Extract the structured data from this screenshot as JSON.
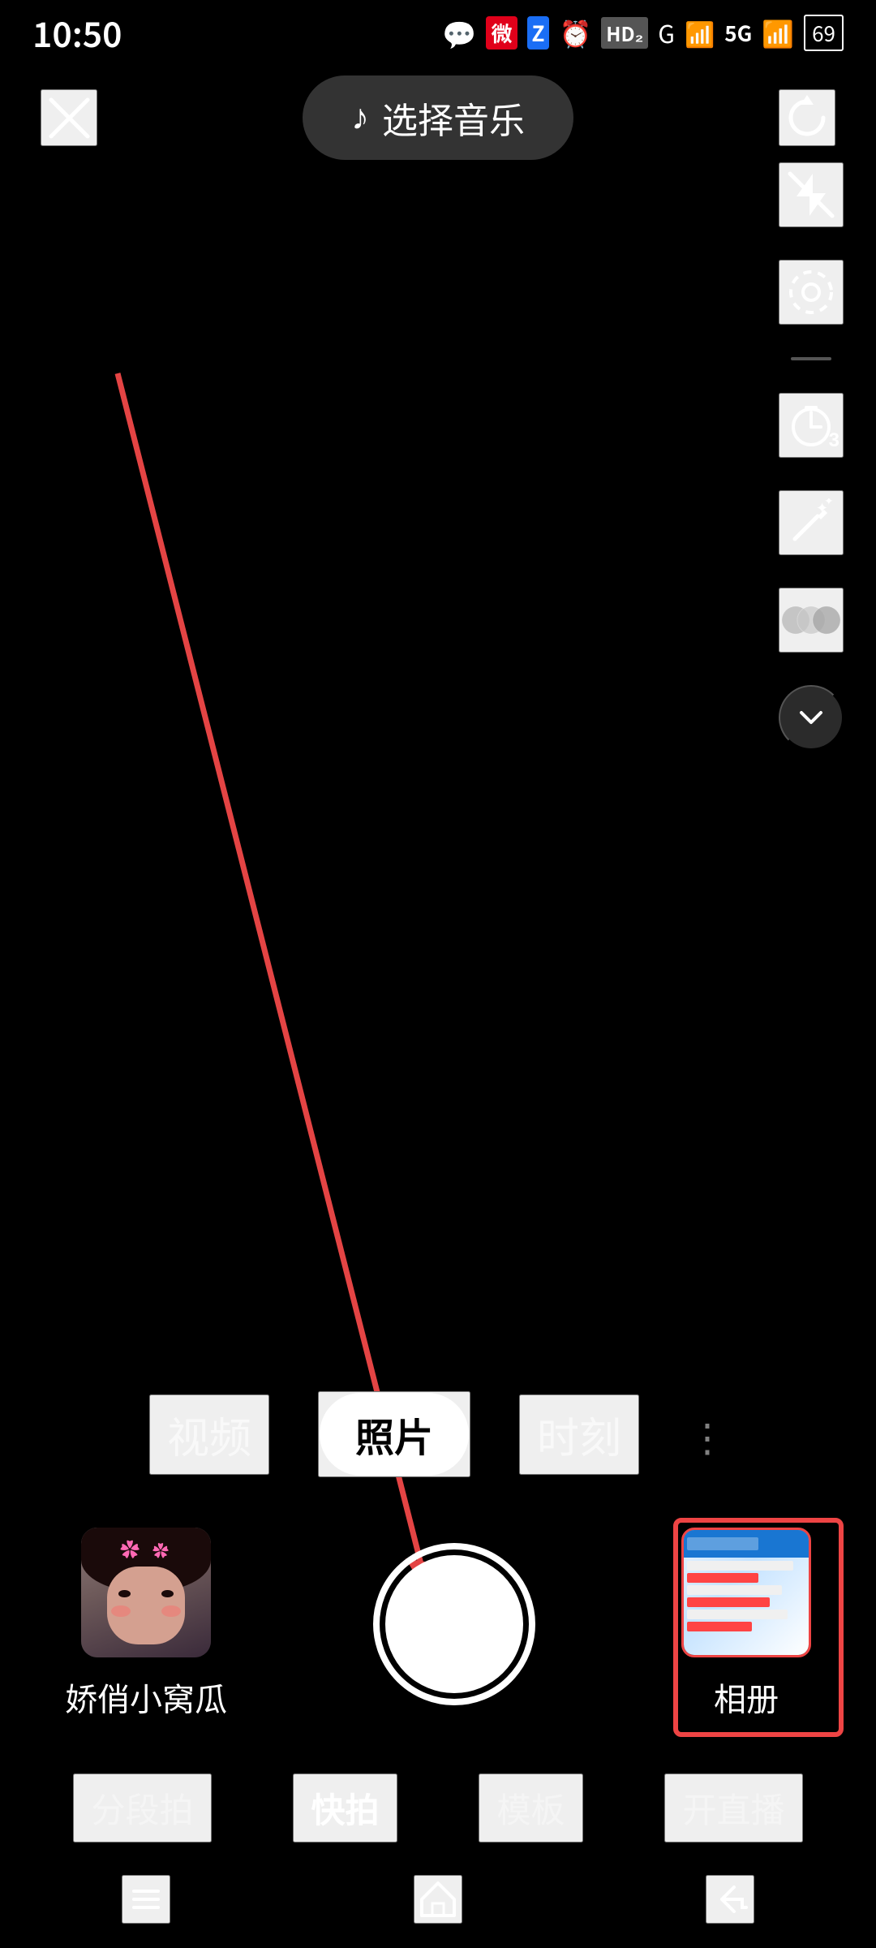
{
  "statusBar": {
    "time": "10:50",
    "icons": [
      "chat",
      "weibo",
      "zhifubao",
      "alarm",
      "hd2",
      "signal-g",
      "signal-5g",
      "wifi",
      "battery-69"
    ]
  },
  "topBar": {
    "closeLabel": "×",
    "musicLabel": "选择音乐",
    "musicNote": "♪",
    "refreshLabel": "↻"
  },
  "toolbar": {
    "flashLabel": "flash-off",
    "settingsLabel": "settings",
    "timerLabel": "timer-3",
    "beautyLabel": "beauty-wand",
    "filterLabel": "filter-circles",
    "moreLabel": "chevron-down"
  },
  "modeTabs": {
    "tabs": [
      {
        "label": "视频",
        "active": false
      },
      {
        "label": "照片",
        "active": true
      },
      {
        "label": "时刻",
        "active": false
      }
    ],
    "moreIcon": "⋮"
  },
  "captureArea": {
    "userName": "娇俏小窝瓜",
    "albumLabel": "相册"
  },
  "shortcuts": [
    {
      "label": "分段拍",
      "active": false
    },
    {
      "label": "快拍",
      "active": true
    },
    {
      "label": "模板",
      "active": false
    },
    {
      "label": "开直播",
      "active": false
    }
  ],
  "systemNav": {
    "menu": "≡",
    "home": "⌂",
    "back": "↩"
  },
  "colors": {
    "accent": "#e44444",
    "background": "#000000",
    "toolbar_bg": "rgba(50,50,50,0.85)"
  }
}
